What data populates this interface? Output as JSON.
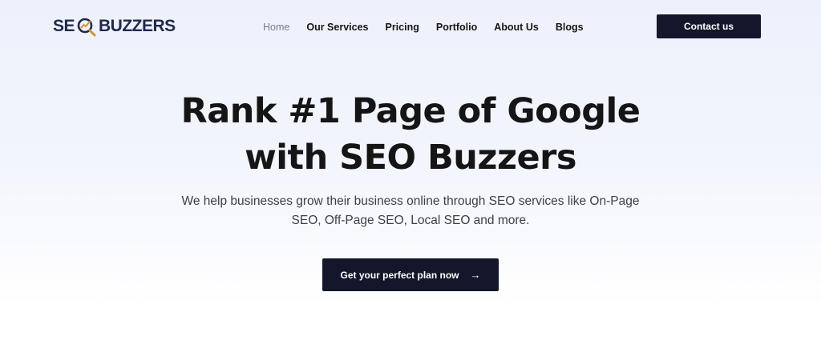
{
  "brand": {
    "logo_left": "SE",
    "logo_right": "BUZZERS",
    "logo_icon": "magnifier-chart-icon",
    "colors": {
      "navy": "#1f2a4a",
      "accent": "#d6942f"
    }
  },
  "nav": {
    "items": [
      {
        "label": "Home",
        "active": true
      },
      {
        "label": "Our Services",
        "active": false
      },
      {
        "label": "Pricing",
        "active": false
      },
      {
        "label": "Portfolio",
        "active": false
      },
      {
        "label": "About Us",
        "active": false
      },
      {
        "label": "Blogs",
        "active": false
      }
    ],
    "contact_label": "Contact us"
  },
  "hero": {
    "title_line1": "Rank #1 Page of Google",
    "title_line2": "with SEO Buzzers",
    "subtitle": "We help businesses grow their business online through SEO services like On-Page SEO, Off-Page SEO, Local SEO and more.",
    "cta_label": "Get your perfect plan now",
    "cta_icon": "arrow-right-icon"
  },
  "theme": {
    "button_bg": "#14162b",
    "active_nav": "#7a7f8a"
  }
}
